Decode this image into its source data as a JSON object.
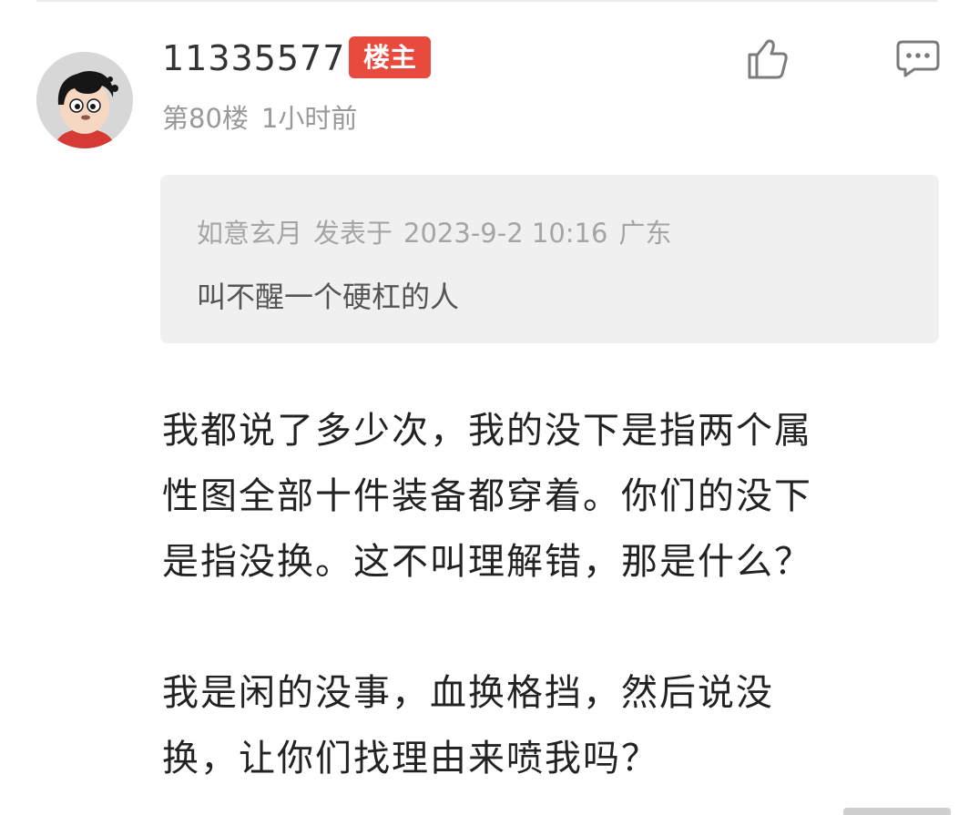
{
  "comment": {
    "username": "11335577",
    "op_badge": "楼主",
    "floor": "第80楼",
    "time": "1小时前",
    "quote": {
      "author": "如意玄月",
      "posted_label": "发表于",
      "datetime": "2023-9-2 10:16",
      "location": "广东",
      "text": "叫不醒一个硬杠的人"
    },
    "paragraphs": [
      [
        "我都说了多少次，我的没下是指两个属",
        "性图全部十件装备都穿着。你们的没下",
        "是指没换。这不叫理解错，那是什么？"
      ],
      [
        "我是闲的没事，血换格挡，然后说没",
        "换，让你们找理由来喷我吗？"
      ]
    ]
  },
  "icons": {
    "avatar": "cartoon-boy-avatar",
    "like": "thumbs-up-icon",
    "reply": "comment-bubble-icon"
  },
  "colors": {
    "badge_bg": "#e84a3d",
    "muted_text": "#999999",
    "quote_bg": "#f0f0f0",
    "body_text": "#222222"
  }
}
